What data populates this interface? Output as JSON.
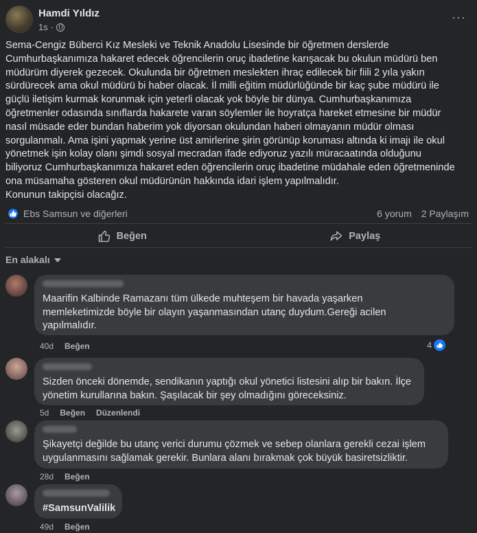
{
  "post": {
    "author": "Hamdi Yıldız",
    "time": "1s",
    "separator": "·",
    "more": "···",
    "text": "Sema-Cengiz Büberci Kız Mesleki ve Teknik Anadolu Lisesinde bir öğretmen derslerde\nCumhurbaşkanımıza hakaret edecek öğrencilerin oruç ibadetine karışacak bu okulun müdürü ben\nmüdürüm diyerek gezecek. Okulunda bir öğretmen meslekten ihraç edilecek bir fiili 2 yıla yakın\nsürdürecek ama okul müdürü bi haber olacak. İl milli eğitim müdürlüğünde bir kaç şube müdürü ile\ngüçlü iletişim kurmak korunmak için yeterli olacak yok böyle bir dünya. Cumhurbaşkanımıza\nöğretmenler odasında sınıflarda hakarete varan söylemler ile hoyratça hareket etmesine bir müdür\nnasıl müsade eder bundan haberim yok diyorsan okulundan haberi olmayanın müdür olması\nsorgulanmalı. Ama işini yapmak yerine üst amirlerine şirin görünüp koruması altında ki imajı ile okul\nyönetmek işin kolay olanı şimdi sosyal mecradan ifade ediyoruz yazılı müracaatında olduğunu\nbiliyoruz Cumhurbaşkanımıza hakaret eden öğrencilerin oruç ibadetine müdahale eden öğretmeninde\nona müsamaha gösteren okul müdürünün hakkında idari işlem yapılmalıdır.\nKonunun takipçisi olacağız.",
    "reactions_text": "Ebs Samsun ve diğerleri",
    "comments_count": "6 yorum",
    "shares_count": "2 Paylaşım",
    "like_label": "Beğen",
    "share_label": "Paylaş"
  },
  "sort_label": "En alakalı",
  "comments": [
    {
      "text": "Maarifin Kalbinde Ramazanı tüm ülkede muhteşem bir havada yaşarken\nmemleketimizde böyle bir olayın yaşanmasından utanç duydum.Gereği acilen\nyapılmalıdır.",
      "time": "40d",
      "like": "Beğen",
      "reaction_count": "4"
    },
    {
      "text": "Sizden önceki dönemde, sendikanın yaptığı okul yönetici listesini alıp bir bakın. İlçe\nyönetim kurullarına bakın. Şaşılacak bir şey olmadığını göreceksiniz.",
      "time": "5d",
      "like": "Beğen",
      "edited": "Düzenlendi"
    },
    {
      "text": "Şikayetçi değilde bu utanç verici durumu çözmek ve sebep olanlara gerekli cezai işlem\nuygulanmasını sağlamak gerekir. Bunlara alanı bırakmak çok büyük basiretsizliktir.",
      "time": "28d",
      "like": "Beğen"
    },
    {
      "text": "#SamsunValilik",
      "time": "49d",
      "like": "Beğen"
    }
  ],
  "colors": {
    "background": "#242526",
    "bubble": "#3a3b3c",
    "accent": "#1877f2",
    "text": "#e4e6eb",
    "muted": "#b0b3b8"
  }
}
